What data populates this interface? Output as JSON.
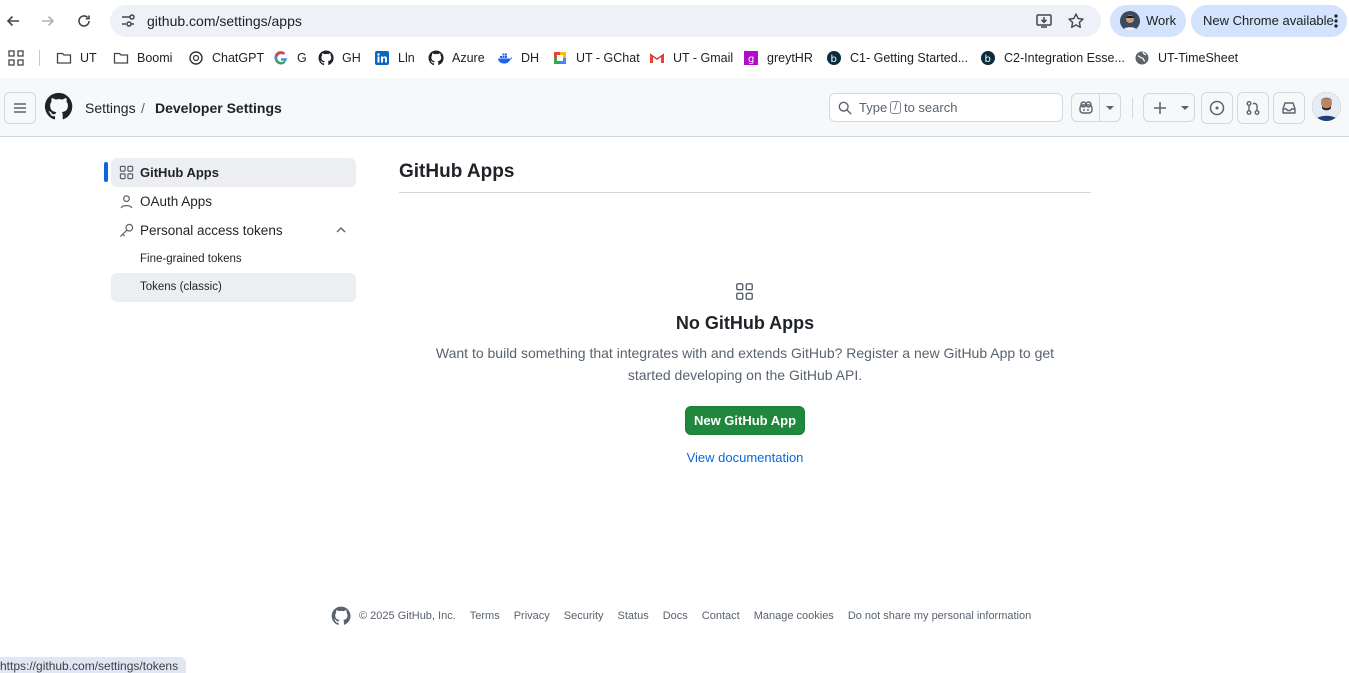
{
  "browser": {
    "url": "github.com/settings/apps",
    "profile_label": "Work",
    "update_label": "New Chrome available",
    "bookmarks": [
      {
        "label": "UT",
        "icon": "folder-icon"
      },
      {
        "label": "Boomi",
        "icon": "folder-icon"
      },
      {
        "label": "ChatGPT",
        "icon": "chatgpt-icon"
      },
      {
        "label": "G",
        "icon": "google-icon"
      },
      {
        "label": "GH",
        "icon": "github-icon"
      },
      {
        "label": "Lln",
        "icon": "linkedin-icon"
      },
      {
        "label": "Azure",
        "icon": "github-icon"
      },
      {
        "label": "DH",
        "icon": "docker-icon"
      },
      {
        "label": "UT - GChat",
        "icon": "gchat-icon"
      },
      {
        "label": "UT - Gmail",
        "icon": "gmail-icon"
      },
      {
        "label": "greytHR",
        "icon": "greythr-icon"
      },
      {
        "label": "C1- Getting Started...",
        "icon": "boomi-b-icon"
      },
      {
        "label": "C2-Integration Esse...",
        "icon": "boomi-b-icon"
      },
      {
        "label": "UT-TimeSheet",
        "icon": "globe-icon"
      }
    ],
    "status_url": "https://github.com/settings/tokens"
  },
  "header": {
    "crumb_settings": "Settings",
    "crumb_separator": "/",
    "crumb_current": "Developer Settings",
    "search_prefix": "Type",
    "search_key": "/",
    "search_suffix": "to search"
  },
  "sidebar": {
    "items": [
      {
        "label": "GitHub Apps",
        "icon": "apps-grid-icon",
        "active": true
      },
      {
        "label": "OAuth Apps",
        "icon": "person-icon"
      },
      {
        "label": "Personal access tokens",
        "icon": "key-icon",
        "expanded": true
      },
      {
        "label": "Fine-grained tokens"
      },
      {
        "label": "Tokens (classic)"
      }
    ]
  },
  "main": {
    "title": "GitHub Apps",
    "blank_title": "No GitHub Apps",
    "blank_text": "Want to build something that integrates with and extends GitHub? Register a new GitHub App to get started developing on the GitHub API.",
    "primary_button": "New GitHub App",
    "doc_link": "View documentation"
  },
  "footer": {
    "copyright": "© 2025 GitHub, Inc.",
    "links": [
      "Terms",
      "Privacy",
      "Security",
      "Status",
      "Docs",
      "Contact",
      "Manage cookies",
      "Do not share my personal information"
    ]
  },
  "colors": {
    "primary_button": "#1f883d",
    "link": "#0969da",
    "active_marker": "#0969da",
    "chrome_chip": "#d3e3fd"
  }
}
